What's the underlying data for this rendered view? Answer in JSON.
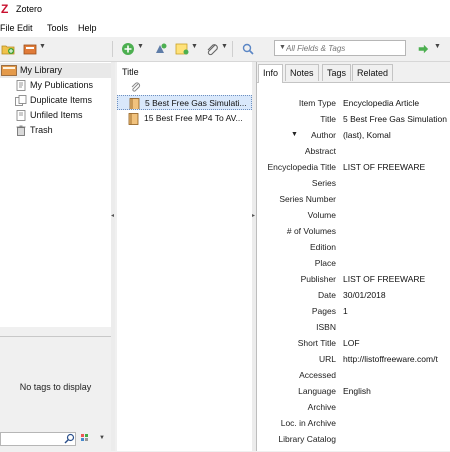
{
  "window": {
    "title": "Zotero"
  },
  "menu": {
    "file": "File",
    "edit": "Edit",
    "tools": "Tools",
    "help": "Help"
  },
  "search": {
    "placeholder": "All Fields & Tags"
  },
  "library": {
    "items": [
      {
        "label": "My Library",
        "icon": "library-icon"
      },
      {
        "label": "My Publications",
        "icon": "publications-icon"
      },
      {
        "label": "Duplicate Items",
        "icon": "duplicate-icon"
      },
      {
        "label": "Unfiled Items",
        "icon": "unfiled-icon"
      },
      {
        "label": "Trash",
        "icon": "trash-icon"
      }
    ]
  },
  "tags": {
    "empty_text": "No tags to display"
  },
  "items": {
    "column_title": "Title",
    "rows": [
      {
        "title": "5 Best Free Gas Simulati..."
      },
      {
        "title": "15 Best Free MP4 To AV..."
      }
    ]
  },
  "detail": {
    "tabs": [
      "Info",
      "Notes",
      "Tags",
      "Related"
    ],
    "fields": [
      {
        "label": "Item Type",
        "value": "Encyclopedia Article"
      },
      {
        "label": "Title",
        "value": "5 Best Free Gas Simulation"
      },
      {
        "label": "Author",
        "value": "(last), Komal"
      },
      {
        "label": "Abstract",
        "value": ""
      },
      {
        "label": "Encyclopedia Title",
        "value": "LIST OF FREEWARE"
      },
      {
        "label": "Series",
        "value": ""
      },
      {
        "label": "Series Number",
        "value": ""
      },
      {
        "label": "Volume",
        "value": ""
      },
      {
        "label": "# of Volumes",
        "value": ""
      },
      {
        "label": "Edition",
        "value": ""
      },
      {
        "label": "Place",
        "value": ""
      },
      {
        "label": "Publisher",
        "value": "LIST OF FREEWARE"
      },
      {
        "label": "Date",
        "value": "30/01/2018"
      },
      {
        "label": "Pages",
        "value": "1"
      },
      {
        "label": "ISBN",
        "value": ""
      },
      {
        "label": "Short Title",
        "value": "LOF"
      },
      {
        "label": "URL",
        "value": "http://listoffreeware.com/t"
      },
      {
        "label": "Accessed",
        "value": ""
      },
      {
        "label": "Language",
        "value": "English"
      },
      {
        "label": "Archive",
        "value": ""
      },
      {
        "label": "Loc. in Archive",
        "value": ""
      },
      {
        "label": "Library Catalog",
        "value": ""
      }
    ]
  }
}
